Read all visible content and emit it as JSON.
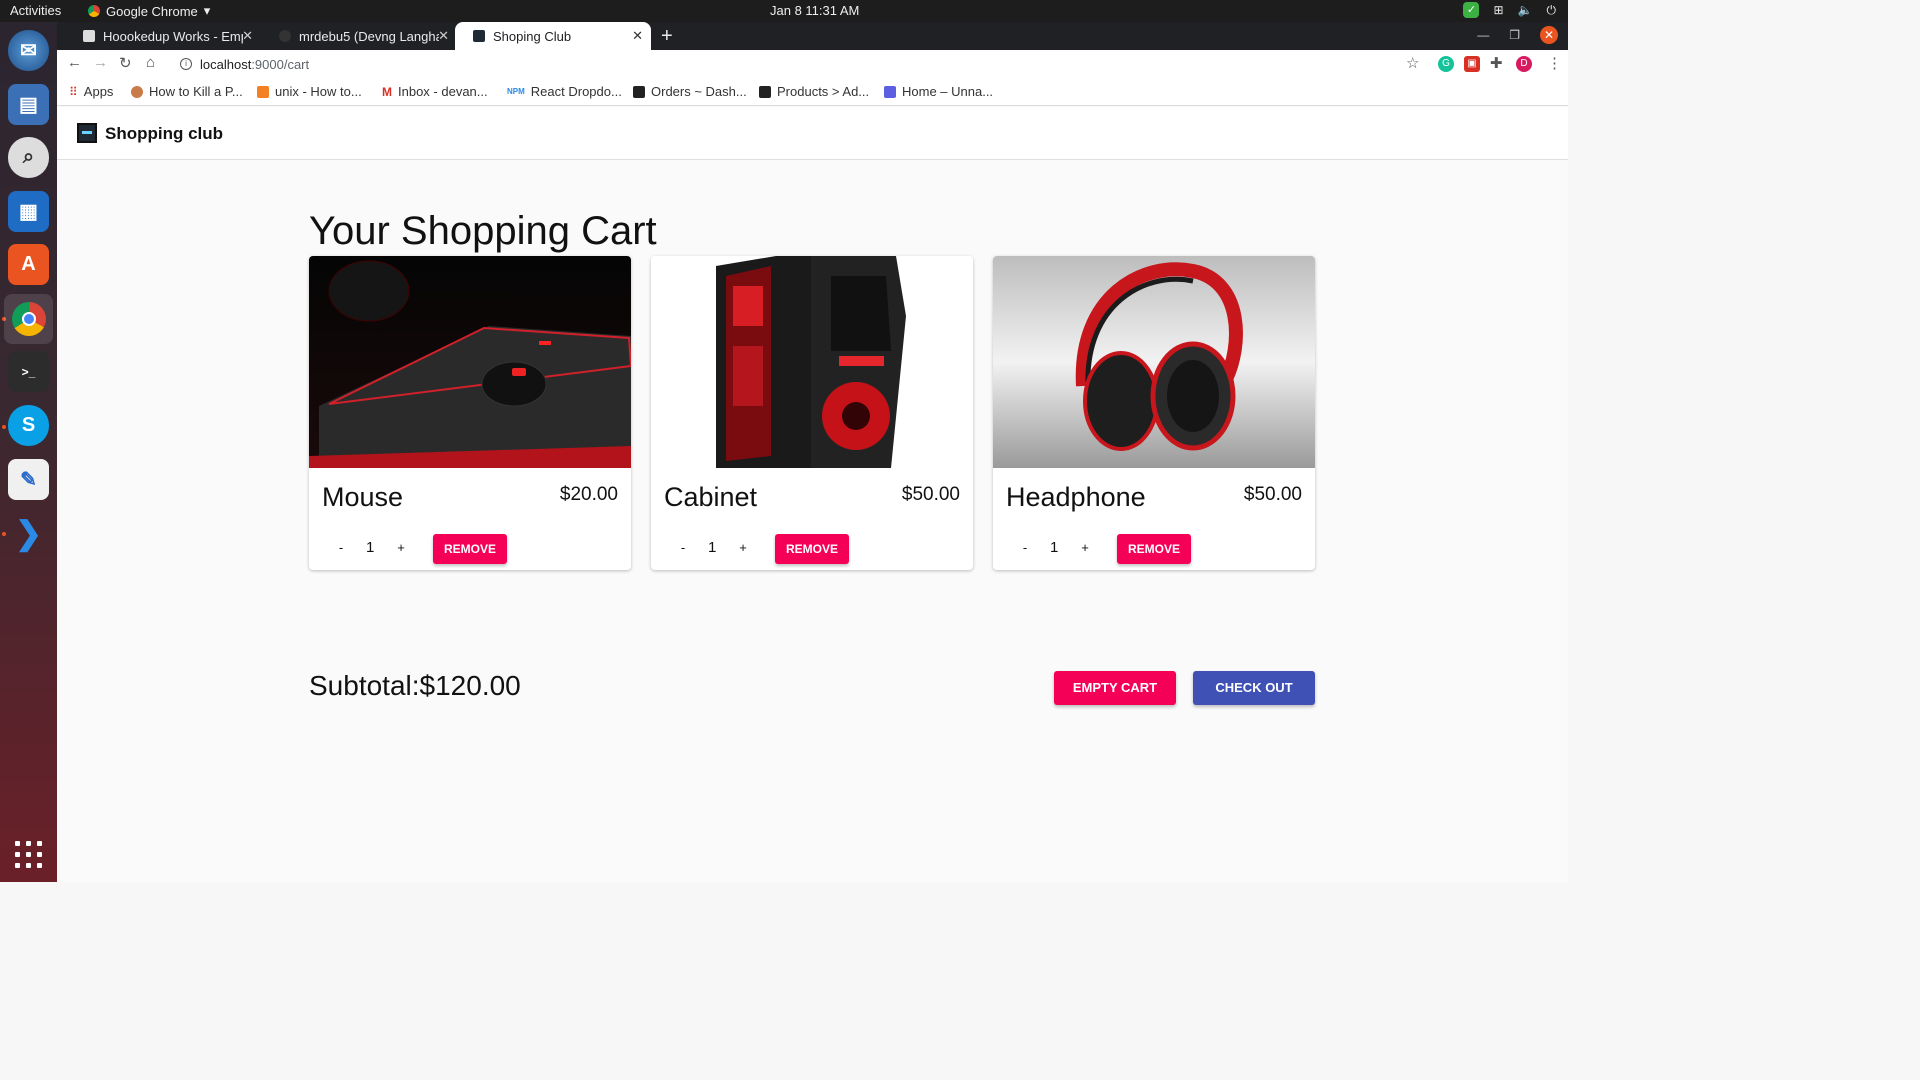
{
  "os": {
    "activities": "Activities",
    "app_name": "Google Chrome",
    "clock": "Jan 8  11:31 AM"
  },
  "browser": {
    "tabs": [
      {
        "title": "Hoookedup Works - Empl"
      },
      {
        "title": "mrdebu5 (Devng Langhar"
      },
      {
        "title": "Shoping Club"
      }
    ],
    "url_host": "localhost",
    "url_path": ":9000/cart",
    "profile_initial": "D",
    "bookmarks": [
      {
        "label": "Apps"
      },
      {
        "label": "How to Kill a P..."
      },
      {
        "label": "unix - How to..."
      },
      {
        "label": "Inbox - devan..."
      },
      {
        "label": "React Dropdo..."
      },
      {
        "label": "Orders ~ Dash..."
      },
      {
        "label": "Products > Ad..."
      },
      {
        "label": "Home – Unna..."
      }
    ]
  },
  "app": {
    "brand": "Shopping club",
    "heading": "Your Shopping Cart",
    "items": [
      {
        "name": "Mouse",
        "price": "$20.00",
        "qty": "1",
        "minus": "-",
        "plus": "+",
        "remove": "REMOVE"
      },
      {
        "name": "Cabinet",
        "price": "$50.00",
        "qty": "1",
        "minus": "-",
        "plus": "+",
        "remove": "REMOVE"
      },
      {
        "name": "Headphone",
        "price": "$50.00",
        "qty": "1",
        "minus": "-",
        "plus": "+",
        "remove": "REMOVE"
      }
    ],
    "subtotal": "Subtotal:$120.00",
    "empty_cart": "EMPTY CART",
    "check_out": "CHECK OUT"
  },
  "colors": {
    "accent_pink": "#f50057",
    "accent_indigo": "#3f51b5"
  }
}
